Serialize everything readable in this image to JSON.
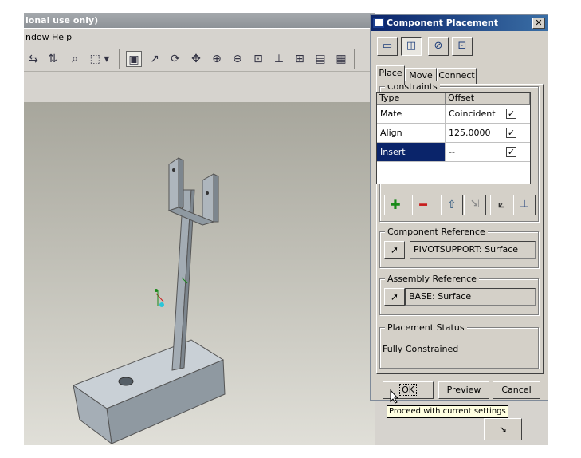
{
  "app": {
    "title_fragment": "ional use only)",
    "menu": [
      "ndow",
      "Help"
    ]
  },
  "dialog": {
    "title": "Component Placement",
    "close_label": "✕",
    "tabs": [
      {
        "label": "Place"
      },
      {
        "label": "Move"
      },
      {
        "label": "Connect"
      }
    ],
    "constraints": {
      "label": "Constraints",
      "headers": [
        "Type",
        "Offset"
      ],
      "rows": [
        {
          "type": "Mate",
          "offset": "Coincident",
          "check": "✓"
        },
        {
          "type": "Align",
          "offset": "125.0000",
          "check": "✓"
        },
        {
          "type": "Insert",
          "offset": "--",
          "check": "✓"
        }
      ]
    },
    "component_reference": {
      "label": "Component Reference",
      "value": "PIVOTSUPPORT: Surface"
    },
    "assembly_reference": {
      "label": "Assembly Reference",
      "value": "BASE: Surface"
    },
    "placement_status": {
      "label": "Placement Status",
      "value": "Fully Constrained"
    },
    "buttons": {
      "ok": "OK",
      "preview": "Preview",
      "cancel": "Cancel"
    },
    "tooltip": "Proceed with current settings"
  },
  "colors": {
    "dialog_title_bg": "#0a246a",
    "selected_row": "#0a246a",
    "add_icon": "#1a8a1a",
    "remove_icon": "#c81e1e"
  }
}
